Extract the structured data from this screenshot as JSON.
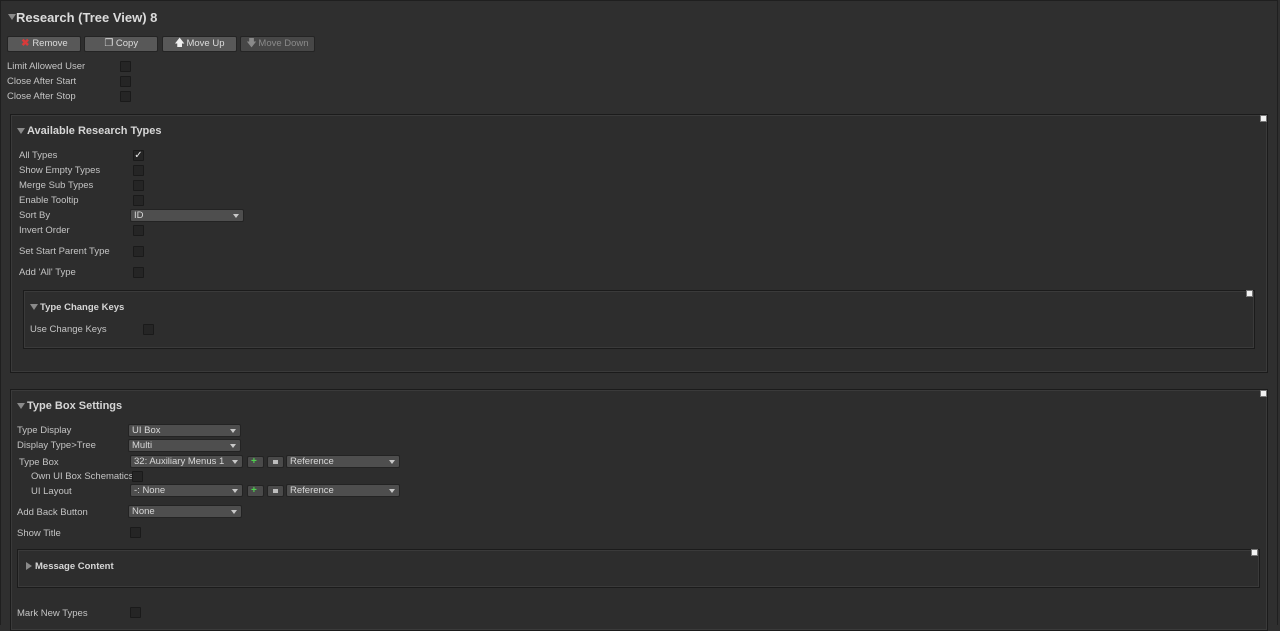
{
  "header": {
    "title": "Research (Tree View) 8"
  },
  "toolbar": {
    "remove": "Remove",
    "copy": "Copy",
    "move_up": "Move Up",
    "move_down": "Move Down"
  },
  "top_options": [
    {
      "label": "Limit Allowed User",
      "checked": false
    },
    {
      "label": "Close After Start",
      "checked": false
    },
    {
      "label": "Close After Stop",
      "checked": false
    }
  ],
  "available_types": {
    "title": "Available Research Types",
    "all_types": {
      "label": "All Types",
      "checked": true
    },
    "show_empty": {
      "label": "Show Empty Types",
      "checked": false
    },
    "merge_sub": {
      "label": "Merge Sub Types",
      "checked": false
    },
    "enable_tooltip": {
      "label": "Enable Tooltip",
      "checked": false
    },
    "sort_by": {
      "label": "Sort By",
      "value": "ID"
    },
    "invert_order": {
      "label": "Invert Order",
      "checked": false
    },
    "set_start_parent": {
      "label": "Set Start Parent Type",
      "checked": false
    },
    "add_all": {
      "label": "Add 'All' Type",
      "checked": false
    },
    "change_keys": {
      "title": "Type Change Keys",
      "use_change_keys": {
        "label": "Use Change Keys",
        "checked": false
      }
    }
  },
  "type_box": {
    "title": "Type Box Settings",
    "type_display": {
      "label": "Type Display",
      "value": "UI Box"
    },
    "display_type_tree": {
      "label": "Display Type>Tree",
      "value": "Multi"
    },
    "type_box": {
      "label": "Type Box",
      "value": "32: Auxiliary Menus 1",
      "ref": "Reference"
    },
    "own_schematics": {
      "label": "Own UI Box Schematics",
      "checked": false
    },
    "ui_layout": {
      "label": "UI Layout",
      "value": "-: None",
      "ref": "Reference"
    },
    "add_back_button": {
      "label": "Add Back Button",
      "value": "None"
    },
    "show_title": {
      "label": "Show Title",
      "checked": false
    },
    "message_content": {
      "title": "Message Content"
    },
    "mark_new_types": {
      "label": "Mark New Types",
      "checked": false
    }
  },
  "icons": {
    "remove": "x-icon",
    "copy": "copy-icon",
    "move_up": "arrow-up-icon",
    "move_down": "arrow-down-icon"
  },
  "colors": {
    "background": "#2f2f2f",
    "button": "#585858",
    "checkmark": "#e8e8e8",
    "remove_icon": "#d83a3a",
    "add_icon": "#4fd04f"
  }
}
